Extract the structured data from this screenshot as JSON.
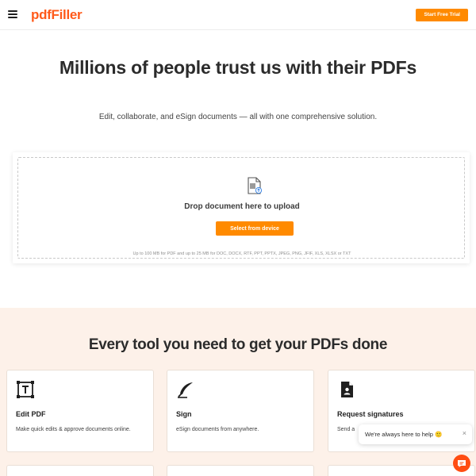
{
  "header": {
    "logo_text": "pdfFiller",
    "trial_label": "Start Free Trial"
  },
  "hero": {
    "title": "Millions of people trust us with their PDFs",
    "subtitle": "Edit, collaborate, and eSign documents — all with one comprehensive solution."
  },
  "upload": {
    "drop_text": "Drop document here to upload",
    "select_label": "Select from device",
    "limits_text": "Up to 100 MB for PDF and up to 25 MB for DOC, DOCX, RTF, PPT, PPTX, JPEG, PNG, JFIF, XLS, XLSX or TXT"
  },
  "tools": {
    "title": "Every tool you need to get your PDFs done",
    "items": [
      {
        "icon": "text-box-icon",
        "name": "Edit PDF",
        "desc": "Make quick edits & approve documents online."
      },
      {
        "icon": "pen-nib-icon",
        "name": "Sign",
        "desc": "eSign documents from anywhere."
      },
      {
        "icon": "document-user-icon",
        "name": "Request signatures",
        "desc": "Send a"
      }
    ]
  },
  "chat": {
    "message": "We're always here to help 🙂",
    "close_glyph": "×"
  },
  "colors": {
    "brand": "#ff5a1a",
    "accent": "#ff8a00",
    "tools_bg": "#fdf1e9",
    "chat": "#ff4d12"
  }
}
